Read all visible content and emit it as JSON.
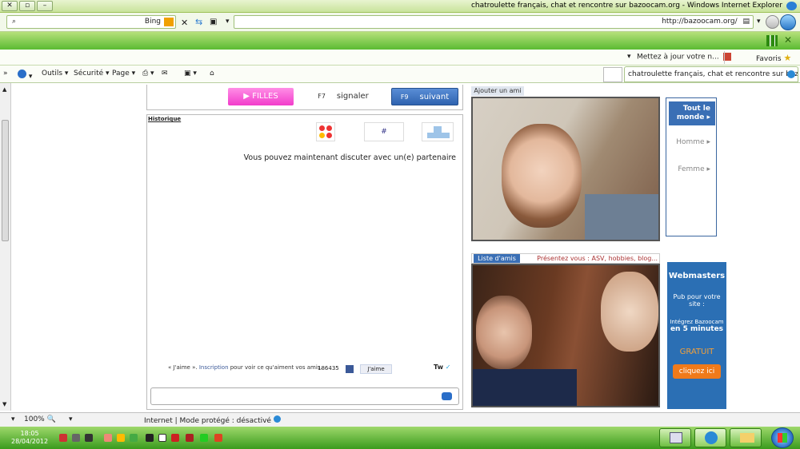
{
  "window": {
    "title": "chatroulette français, chat et rencontre sur bazoocam.org - Windows Internet Explorer",
    "close_glyph": "✕",
    "max_glyph": "▫",
    "min_glyph": "–"
  },
  "address": {
    "url": "http://bazoocam.org/",
    "search_placeholder": "Bing"
  },
  "favorites": {
    "label": "Favoris",
    "item": "Mettez à jour votre n..."
  },
  "tab": {
    "label": "chatroulette français, chat et rencontre sur bazoo..."
  },
  "commands": {
    "page": "Page",
    "security": "Sécurité",
    "tools": "Outils",
    "page_arrow": "▾",
    "security_arrow": "▾",
    "tools_arrow": "▾"
  },
  "controls": {
    "next_label": "suivant",
    "next_key": "F9",
    "report_label": "signaler",
    "report_key": "F7",
    "girls_label": "FILLES",
    "history": "Historique"
  },
  "chat": {
    "message": "Vous pouvez maintenant discuter avec un(e) partenaire",
    "like_label": "J'aime",
    "like_count": "186435",
    "promo_pre": "« J'aime ». ",
    "promo_link": "Inscription",
    "promo_post": " pour voir ce qu'aiment vos amis.",
    "twitter_label": "Tw"
  },
  "video": {
    "add_friend": "Ajouter un ami",
    "friends_list": "Liste d'amis",
    "intro": "Présentez vous : ASV, hobbies, blog..."
  },
  "gender": {
    "all": "Tout le monde",
    "male": "Homme",
    "female": "Femme"
  },
  "webmasters": {
    "title": "Webmasters",
    "line1": "Pub pour votre site :",
    "line2": "Intégrez Bazoocam",
    "line3": "en 5 minutes",
    "free": "GRATUIT",
    "cta": "cliquez ici"
  },
  "status": {
    "zone": "Internet | Mode protégé : désactivé",
    "zoom": "100%"
  },
  "clock": {
    "time": "18:05",
    "date": "28/04/2012"
  },
  "colors": {
    "accent_blue": "#3a6fb5",
    "girls_pink": "#f23ccb",
    "ie_green": "#5bbb32"
  }
}
